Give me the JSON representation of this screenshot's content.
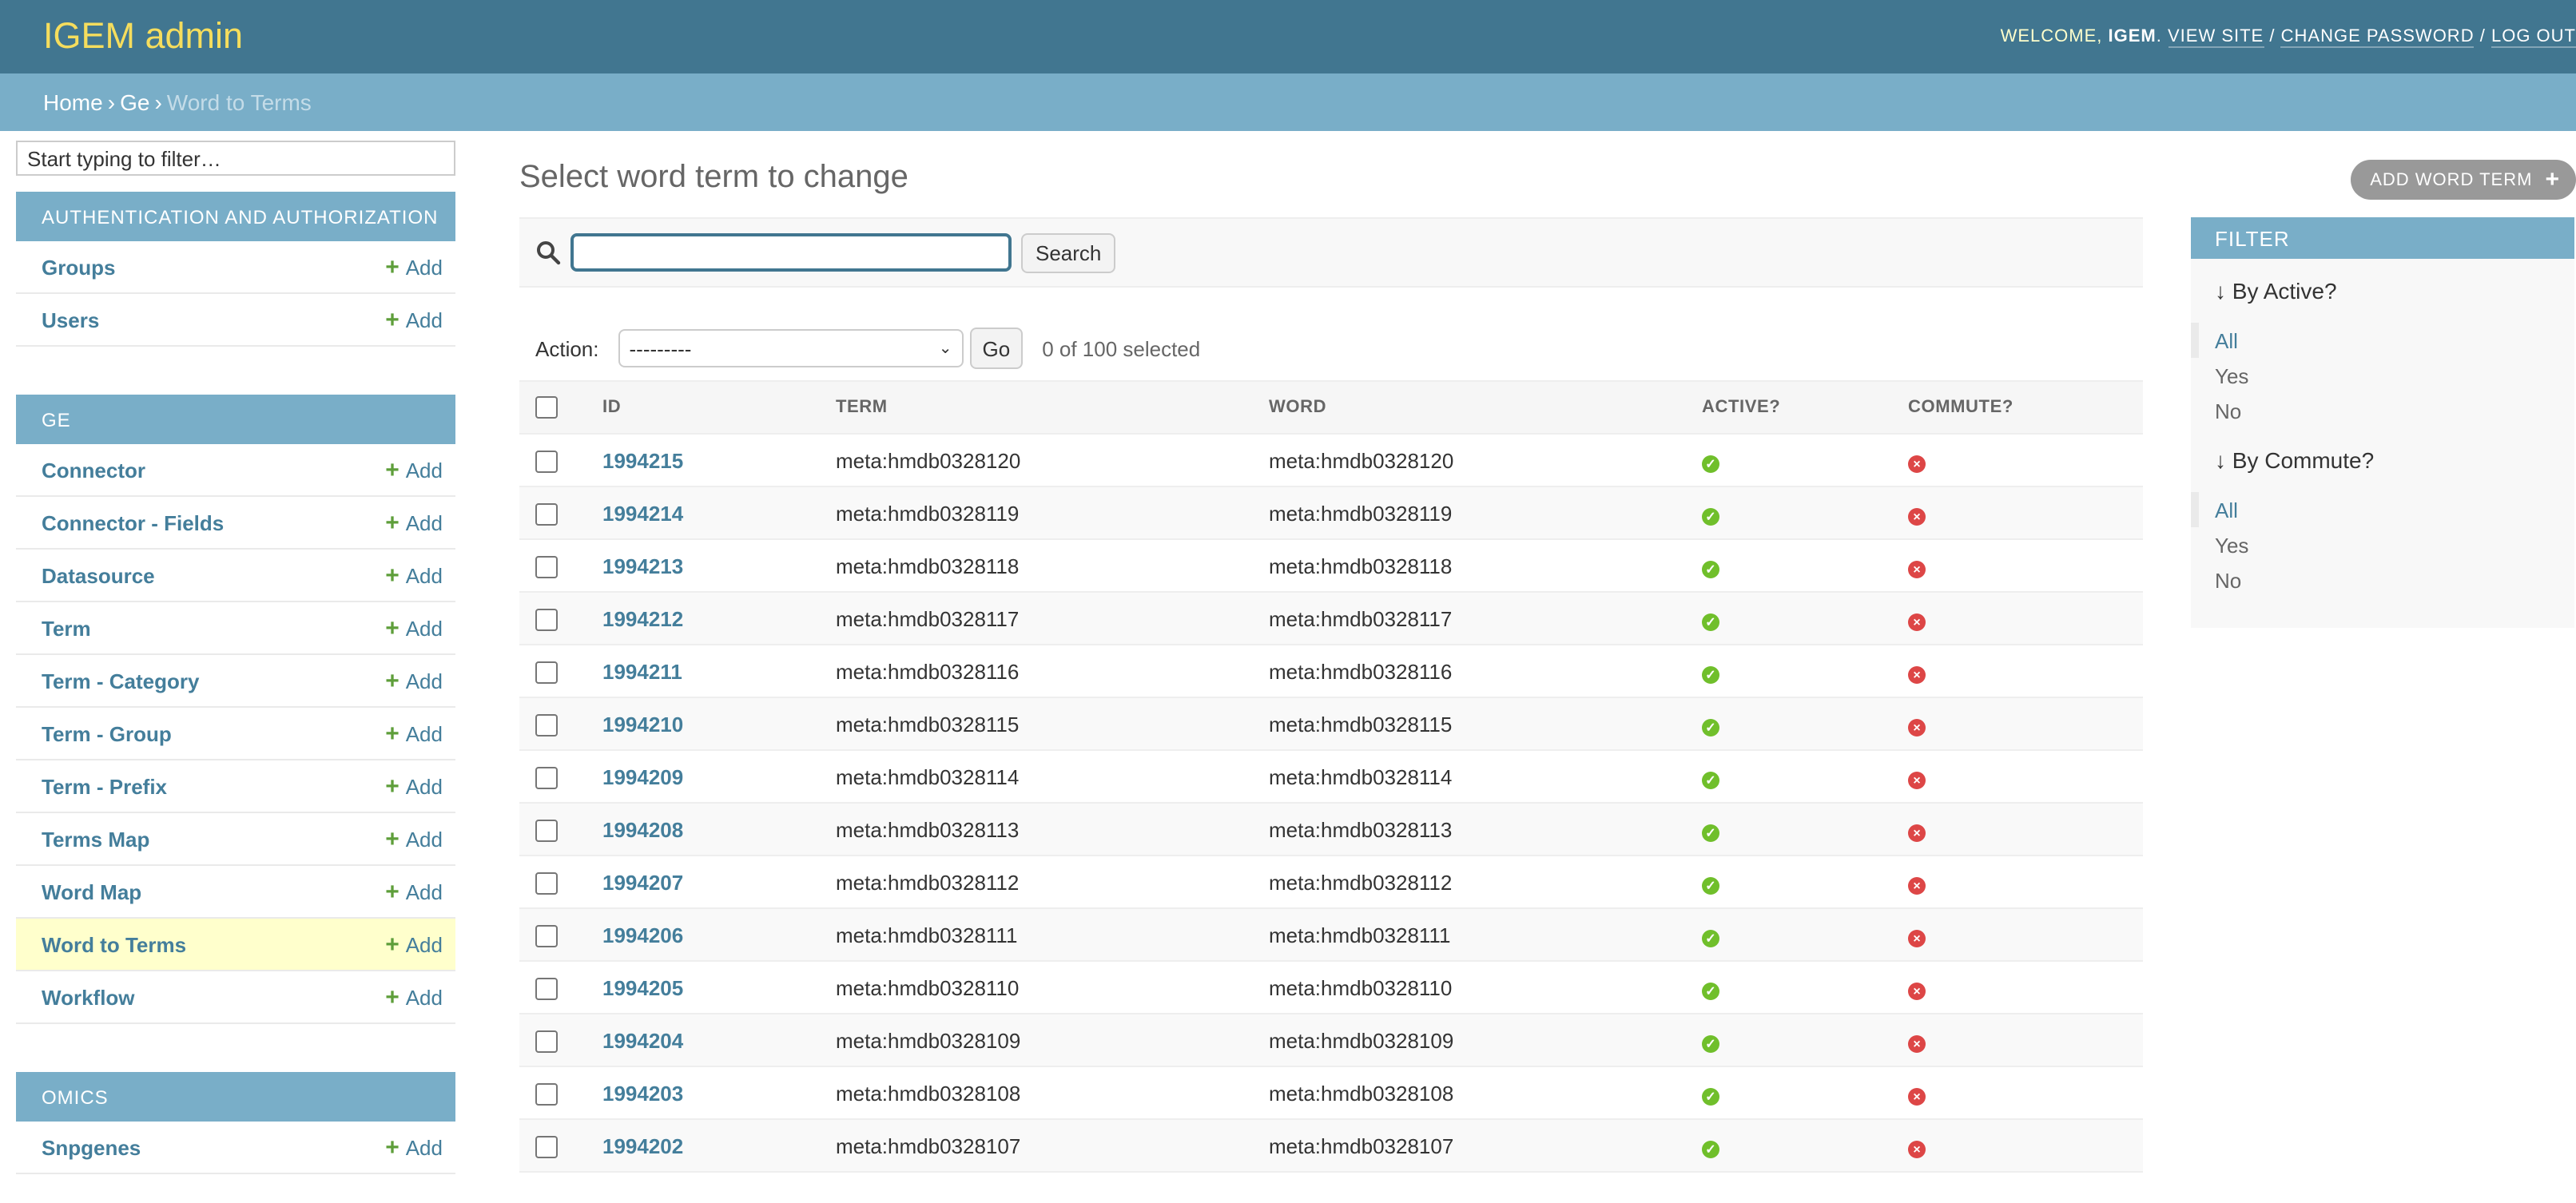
{
  "header": {
    "brand": "IGEM admin",
    "welcome": "WELCOME,",
    "username": "IGEM",
    "view_site": "VIEW SITE",
    "change_password": "CHANGE PASSWORD",
    "log_out": "LOG OUT"
  },
  "breadcrumbs": {
    "home": "Home",
    "app": "Ge",
    "current": "Word to Terms"
  },
  "sidebar": {
    "filter_placeholder": "Start typing to filter…",
    "add_label": "Add",
    "apps": [
      {
        "caption": "AUTHENTICATION AND AUTHORIZATION",
        "models": [
          "Groups",
          "Users"
        ]
      },
      {
        "caption": "GE",
        "models": [
          "Connector",
          "Connector - Fields",
          "Datasource",
          "Term",
          "Term - Category",
          "Term - Group",
          "Term - Prefix",
          "Terms Map",
          "Word Map",
          "Word to Terms",
          "Workflow"
        ]
      },
      {
        "caption": "OMICS",
        "models": [
          "Snpgenes"
        ]
      }
    ]
  },
  "content": {
    "title": "Select word term to change",
    "add_button": "ADD WORD TERM",
    "search_button": "Search",
    "action_label": "Action:",
    "action_selected": "---------",
    "go_button": "Go",
    "counter": "0 of 100 selected"
  },
  "table": {
    "columns": [
      "ID",
      "TERM",
      "WORD",
      "ACTIVE?",
      "COMMUTE?"
    ],
    "rows": [
      {
        "id": "1994215",
        "term": "meta:hmdb0328120",
        "word": "meta:hmdb0328120"
      },
      {
        "id": "1994214",
        "term": "meta:hmdb0328119",
        "word": "meta:hmdb0328119"
      },
      {
        "id": "1994213",
        "term": "meta:hmdb0328118",
        "word": "meta:hmdb0328118"
      },
      {
        "id": "1994212",
        "term": "meta:hmdb0328117",
        "word": "meta:hmdb0328117"
      },
      {
        "id": "1994211",
        "term": "meta:hmdb0328116",
        "word": "meta:hmdb0328116"
      },
      {
        "id": "1994210",
        "term": "meta:hmdb0328115",
        "word": "meta:hmdb0328115"
      },
      {
        "id": "1994209",
        "term": "meta:hmdb0328114",
        "word": "meta:hmdb0328114"
      },
      {
        "id": "1994208",
        "term": "meta:hmdb0328113",
        "word": "meta:hmdb0328113"
      },
      {
        "id": "1994207",
        "term": "meta:hmdb0328112",
        "word": "meta:hmdb0328112"
      },
      {
        "id": "1994206",
        "term": "meta:hmdb0328111",
        "word": "meta:hmdb0328111"
      },
      {
        "id": "1994205",
        "term": "meta:hmdb0328110",
        "word": "meta:hmdb0328110"
      },
      {
        "id": "1994204",
        "term": "meta:hmdb0328109",
        "word": "meta:hmdb0328109"
      },
      {
        "id": "1994203",
        "term": "meta:hmdb0328108",
        "word": "meta:hmdb0328108"
      },
      {
        "id": "1994202",
        "term": "meta:hmdb0328107",
        "word": "meta:hmdb0328107"
      }
    ]
  },
  "filter": {
    "title": "FILTER",
    "groups": [
      {
        "heading": "By Active?",
        "options": [
          "All",
          "Yes",
          "No"
        ],
        "selected": "All"
      },
      {
        "heading": "By Commute?",
        "options": [
          "All",
          "Yes",
          "No"
        ],
        "selected": "All"
      }
    ]
  },
  "colors": {
    "header_bg": "#417690",
    "brand": "#f5dd5d",
    "accent": "#79aec8",
    "link": "#447e9b",
    "current_row": "#ffffcc",
    "yes": "#70bf2b",
    "no": "#dd4646"
  }
}
